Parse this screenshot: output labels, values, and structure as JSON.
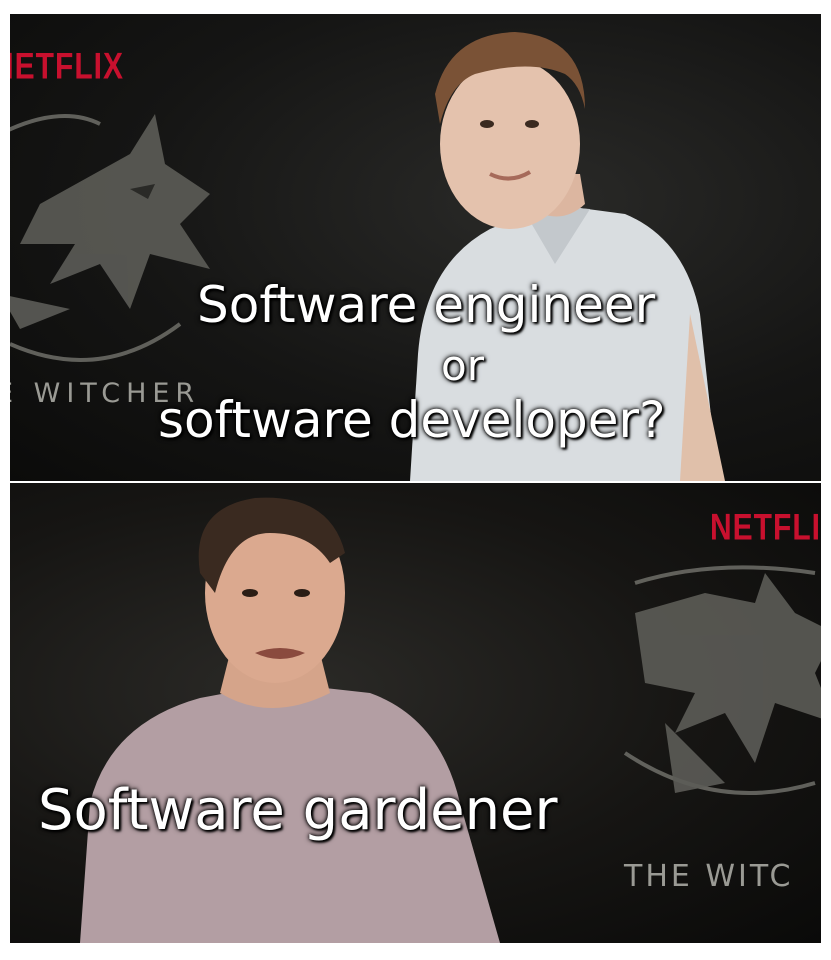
{
  "top_panel": {
    "netflix_logo": "NETFLIX",
    "show_logo_text": "E WITCHER",
    "caption_lines": [
      "Software engineer",
      "or",
      "software developer?"
    ]
  },
  "bottom_panel": {
    "netflix_logo": "NETFLIX",
    "show_logo_text": "THE WITC",
    "caption": "Software gardener"
  },
  "colors": {
    "netflix_red": "#c8102e",
    "background": "#141413",
    "caption_text": "#ffffff",
    "shirt_top": "#d9dde0",
    "shirt_bottom": "#b39ea3"
  },
  "icons": [
    "wolf-medallion-icon"
  ]
}
